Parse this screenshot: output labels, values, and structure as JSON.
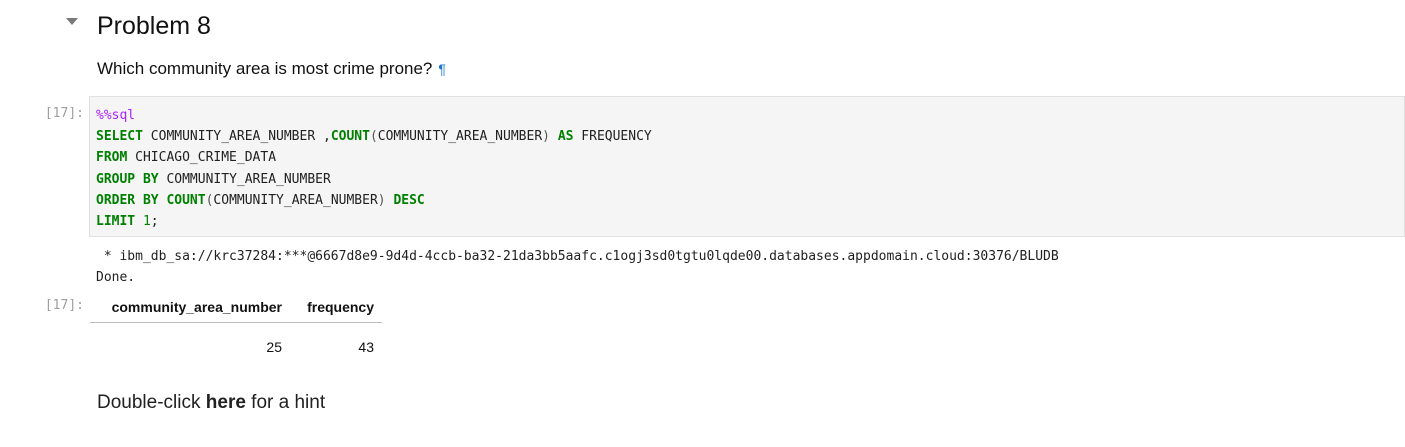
{
  "heading": {
    "title": "Problem 8",
    "question": "Which community area is most crime prone?",
    "anchor": "¶"
  },
  "cell": {
    "input_prompt": "[17]:",
    "output_prompt": "[17]:",
    "code": {
      "line1_magic": "%%sql",
      "line2": {
        "kw_select": "SELECT",
        "col": " COMMUNITY_AREA_NUMBER ,",
        "fn_count": "COUNT",
        "paren_open": "(",
        "arg": "COMMUNITY_AREA_NUMBER",
        "paren_close": ")",
        "kw_as": "AS",
        "alias": " FREQUENCY"
      },
      "line3": {
        "kw_from": "FROM",
        "table": " CHICAGO_CRIME_DATA"
      },
      "line4": {
        "kw_group": "GROUP BY",
        "col": " COMMUNITY_AREA_NUMBER"
      },
      "line5": {
        "kw_order": "ORDER BY",
        "fn_count": "COUNT",
        "paren_open": "(",
        "arg": "COMMUNITY_AREA_NUMBER",
        "paren_close": ")",
        "kw_desc": "DESC"
      },
      "line6": {
        "kw_limit": "LIMIT",
        "num": "1",
        "semi": ";"
      }
    },
    "stdout": {
      "connection": " * ibm_db_sa://krc37284:***@6667d8e9-9d4d-4ccb-ba32-21da3bb5aafc.c1ogj3sd0tgtu0lqde00.databases.appdomain.cloud:30376/BLUDB",
      "done": "Done."
    },
    "table": {
      "headers": [
        "community_area_number",
        "frequency"
      ],
      "rows": [
        [
          "25",
          "43"
        ]
      ]
    }
  },
  "hint": {
    "prefix": "Double-click ",
    "link": "here",
    "suffix": " for a hint"
  }
}
